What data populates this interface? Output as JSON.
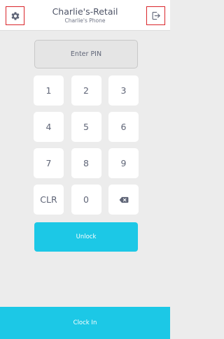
{
  "header": {
    "title": "Charlie's-Retail",
    "subtitle": "Charlie's Phone",
    "settings_icon": "gear-icon",
    "logout_icon": "logout-icon"
  },
  "pin": {
    "placeholder": "Enter PIN"
  },
  "keypad": {
    "keys": [
      "1",
      "2",
      "3",
      "4",
      "5",
      "6",
      "7",
      "8",
      "9",
      "CLR",
      "0"
    ],
    "backspace_icon": "backspace-icon"
  },
  "actions": {
    "unlock_label": "Unlock",
    "clock_in_label": "Clock In"
  },
  "colors": {
    "accent": "#1cc8e6",
    "highlight_border": "#d9262b",
    "background": "#ececec",
    "text": "#5f6577"
  }
}
